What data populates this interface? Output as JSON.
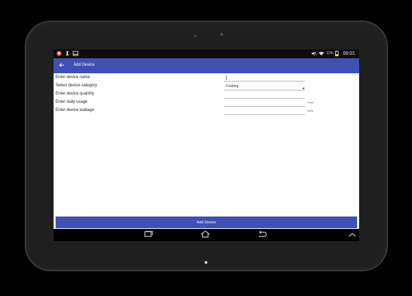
{
  "status_bar": {
    "battery_percent": "22%",
    "time": "00:01",
    "icons": [
      "notification-icon",
      "usb-icon",
      "image-icon",
      "mute-icon",
      "wifi-icon",
      "battery-icon"
    ]
  },
  "app_bar": {
    "title": "Add Device"
  },
  "form": {
    "device_name": {
      "label": "Enter device name",
      "value": ""
    },
    "device_category": {
      "label": "Select device category",
      "value": "Cooking"
    },
    "device_quantity": {
      "label": "Enter device quantity",
      "value": ""
    },
    "daily_usage": {
      "label": "Enter daily usage",
      "value": "",
      "unit": "Hours"
    },
    "device_wattage": {
      "label": "Enter device wattage",
      "value": "",
      "unit": "Watts"
    }
  },
  "actions": {
    "add_device": "Add Device"
  },
  "navigation": {
    "items": [
      "recent-apps",
      "home",
      "back",
      "collapse"
    ]
  },
  "colors": {
    "accent": "#3f51b5",
    "status_bar": "#0d0d0d",
    "frame": "#2a2a2a"
  }
}
